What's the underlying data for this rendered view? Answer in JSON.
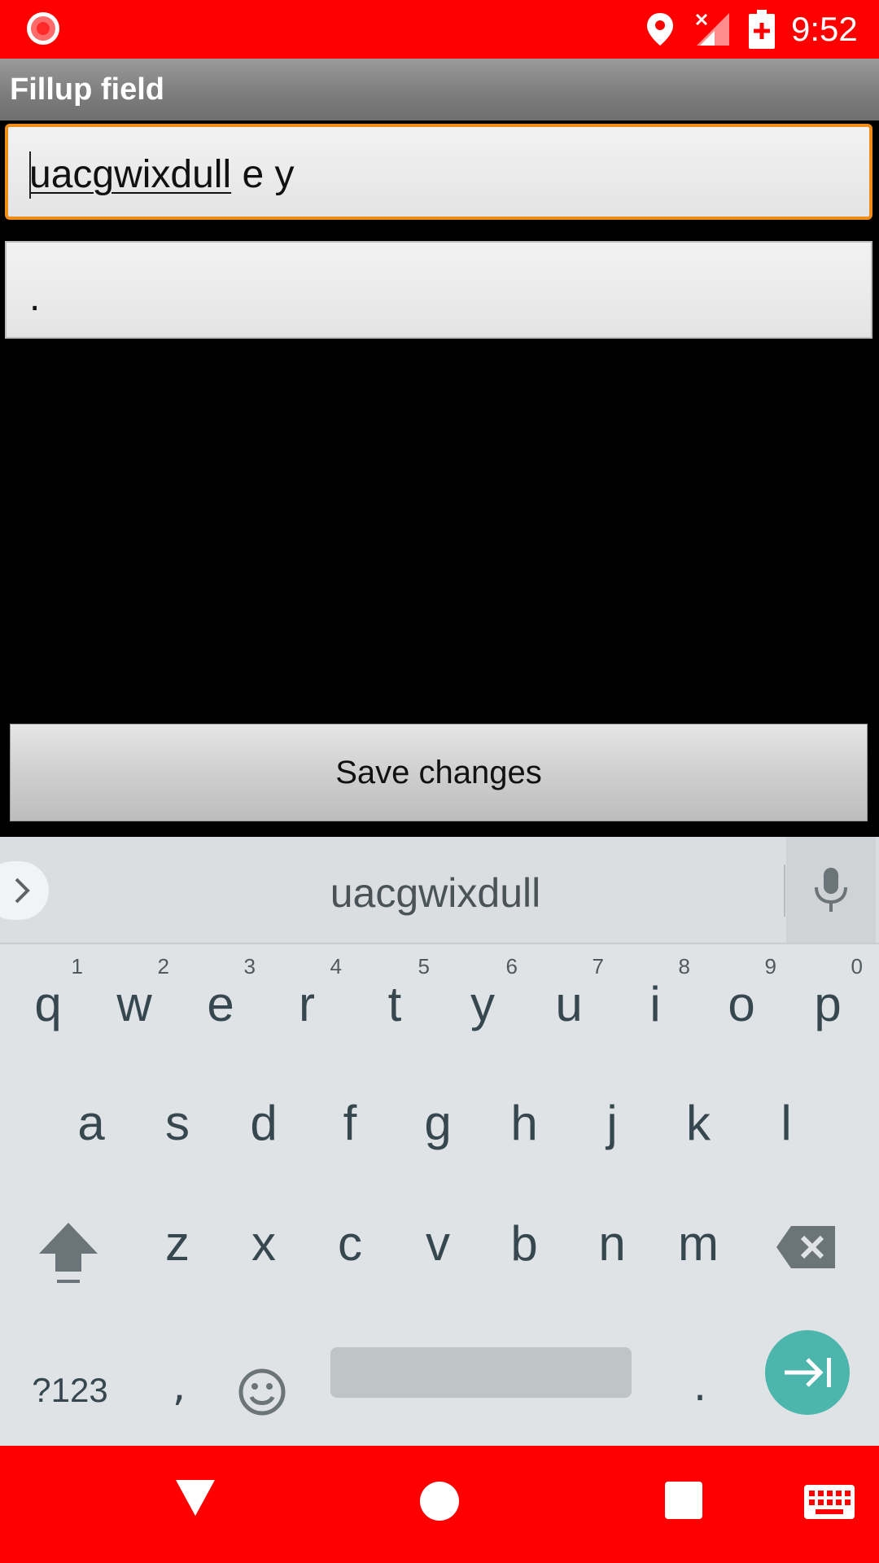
{
  "status_bar": {
    "time": "9:52",
    "icons": [
      "record-icon",
      "location-icon",
      "signal-icon",
      "battery-charging-icon"
    ],
    "background": "#ff0000"
  },
  "title_bar": {
    "title": "Fillup field"
  },
  "form": {
    "field1": {
      "composing_text": "uacgwixdull",
      "rest_text": " e y",
      "focused": true,
      "focus_color": "#f08c1a"
    },
    "field2": {
      "value": "."
    },
    "save_label": "Save changes"
  },
  "keyboard": {
    "suggestion": "uacgwixdull",
    "row1": [
      {
        "key": "q",
        "hint": "1"
      },
      {
        "key": "w",
        "hint": "2"
      },
      {
        "key": "e",
        "hint": "3"
      },
      {
        "key": "r",
        "hint": "4"
      },
      {
        "key": "t",
        "hint": "5"
      },
      {
        "key": "y",
        "hint": "6"
      },
      {
        "key": "u",
        "hint": "7"
      },
      {
        "key": "i",
        "hint": "8"
      },
      {
        "key": "o",
        "hint": "9"
      },
      {
        "key": "p",
        "hint": "0"
      }
    ],
    "row2": [
      "a",
      "s",
      "d",
      "f",
      "g",
      "h",
      "j",
      "k",
      "l"
    ],
    "row3": [
      "z",
      "x",
      "c",
      "v",
      "b",
      "n",
      "m"
    ],
    "symbols_label": "?123",
    "comma_label": ",",
    "period_label": ".",
    "enter_color": "#4db6ac"
  },
  "nav_bar": {
    "icons": [
      "back-icon",
      "home-icon",
      "recents-icon",
      "keyboard-icon"
    ],
    "background": "#ff0000"
  }
}
